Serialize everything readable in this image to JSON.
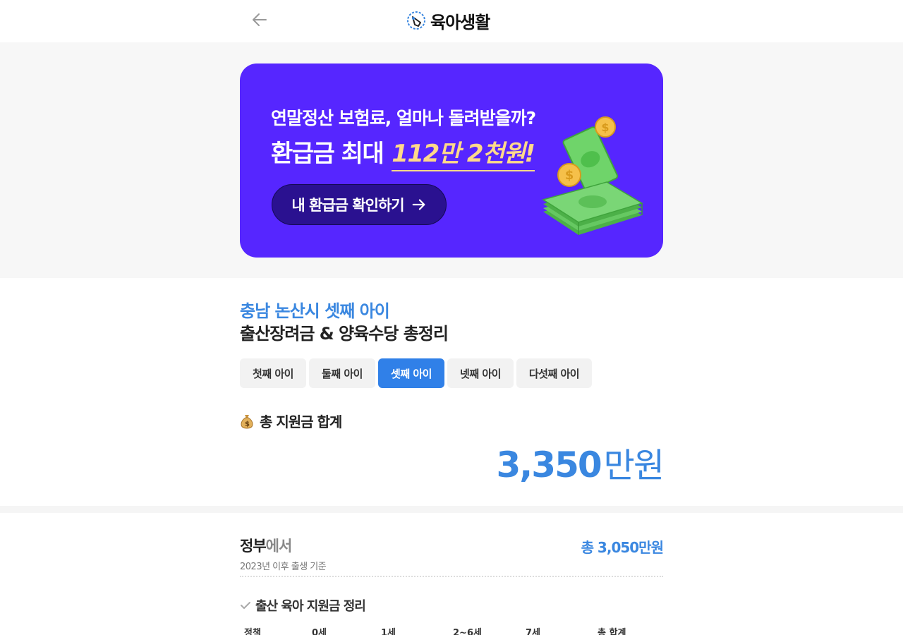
{
  "header": {
    "logo_text": "육아생활"
  },
  "banner": {
    "line1": "연말정산 보험료, 얼마나 돌려받을까?",
    "line2_prefix": "환급금 최대",
    "line2_highlight": "112만 2천원!",
    "cta_label": "내 환급금 확인하기"
  },
  "page": {
    "region_title": "충남 논산시 셋째 아이",
    "main_title": "출산장려금 & 양육수당 총정리"
  },
  "tabs": [
    {
      "label": "첫째 아이",
      "active": false
    },
    {
      "label": "둘째 아이",
      "active": false
    },
    {
      "label": "셋째 아이",
      "active": true
    },
    {
      "label": "넷째 아이",
      "active": false
    },
    {
      "label": "다섯째 아이",
      "active": false
    }
  ],
  "summary": {
    "label": "총 지원금 합계",
    "amount": "3,350",
    "unit": "만원"
  },
  "government": {
    "title_main": "정부",
    "title_suffix": "에서",
    "subtitle": "2023년 이후 출생 기준",
    "total": "총 3,050만원",
    "section_label": "출산 육아 지원금 정리",
    "table_headers": [
      "정책",
      "0세",
      "1세",
      "2~6세",
      "7세",
      "총 합계"
    ]
  },
  "colors": {
    "banner_bg": "#5626ff",
    "accent_blue": "#3a87e0",
    "tab_active": "#3080e8",
    "highlight_gold": "#ffd98a"
  }
}
